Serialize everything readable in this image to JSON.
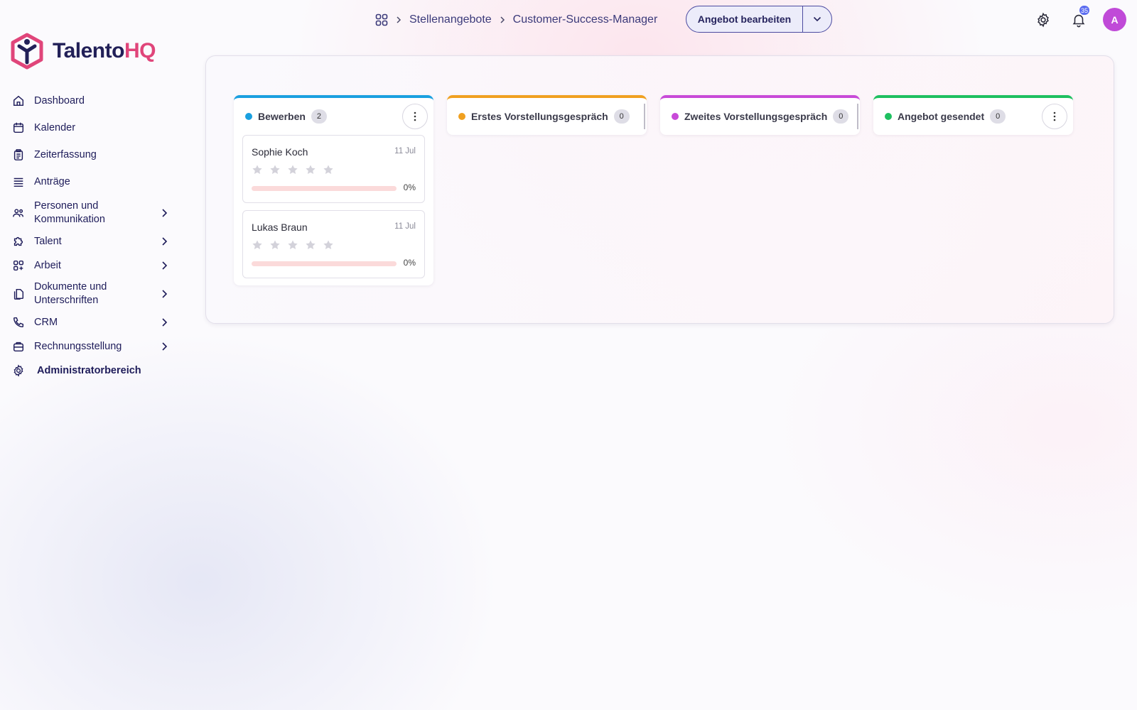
{
  "breadcrumb": {
    "items": [
      "Stellenangebote",
      "Customer-Success-Manager"
    ]
  },
  "header": {
    "primary_action_label": "Angebot bearbeiten",
    "notification_count": "35",
    "avatar_initial": "A"
  },
  "brand": {
    "name_part1": "Talento",
    "name_part2": "HQ",
    "colors": {
      "primary": "#222058",
      "accent": "#e0457a"
    }
  },
  "sidebar": {
    "items": [
      {
        "label": "Dashboard",
        "icon": "home-icon",
        "has_children": false
      },
      {
        "label": "Kalender",
        "icon": "calendar-icon",
        "has_children": false
      },
      {
        "label": "Zeiterfassung",
        "icon": "clipboard-icon",
        "has_children": false
      },
      {
        "label": "Anträge",
        "icon": "stack-icon",
        "has_children": false
      },
      {
        "label_line1": "Personen und",
        "label_line2": "Kommunikation",
        "icon": "people-icon",
        "has_children": true
      },
      {
        "label": "Talent",
        "icon": "puzzle-icon",
        "has_children": true
      },
      {
        "label": "Arbeit",
        "icon": "apps-icon",
        "has_children": true
      },
      {
        "label_line1": "Dokumente und",
        "label_line2": "Unterschriften",
        "icon": "documents-icon",
        "has_children": true
      },
      {
        "label": "CRM",
        "icon": "phone-icon",
        "has_children": true
      },
      {
        "label": "Rechnungsstellung",
        "icon": "briefcase-icon",
        "has_children": true
      },
      {
        "label": "Administratorbereich",
        "icon": "gear-icon",
        "has_children": false
      }
    ]
  },
  "board": {
    "columns": [
      {
        "title": "Bewerben",
        "count": "2",
        "color": "#1aa0e0",
        "cards": [
          {
            "name": "Sophie Koch",
            "date": "11 Jul",
            "rating": 0,
            "progress_label": "0%",
            "progress": 0
          },
          {
            "name": "Lukas Braun",
            "date": "11 Jul",
            "rating": 0,
            "progress_label": "0%",
            "progress": 0
          }
        ]
      },
      {
        "title": "Erstes Vorstellungsgespräch",
        "count": "0",
        "color": "#f0a020",
        "cards": []
      },
      {
        "title": "Zweites Vorstellungsgespräch",
        "count": "0",
        "color": "#c84ad8",
        "cards": []
      },
      {
        "title": "Angebot gesendet",
        "count": "0",
        "color": "#1ec060",
        "cards": []
      }
    ]
  }
}
